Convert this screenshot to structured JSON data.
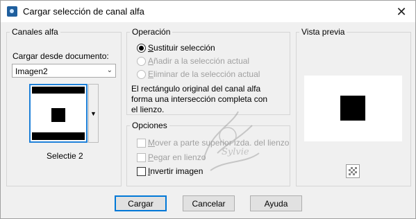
{
  "window": {
    "title": "Cargar selección de canal alfa",
    "close_symbol": "✕"
  },
  "channels": {
    "group_label": "Canales alfa",
    "load_from_label": "Cargar desde documento:",
    "document_value": "Imagen2",
    "selected_channel": "Selectie 2"
  },
  "operation": {
    "group_label": "Operación",
    "options": [
      {
        "label": "Sustituir selección",
        "checked": true,
        "enabled": true
      },
      {
        "label": "Añadir a la selección actual",
        "checked": false,
        "enabled": false
      },
      {
        "label": "Eliminar de la selección actual",
        "checked": false,
        "enabled": false
      }
    ],
    "description_lines": [
      "El rectángulo original del canal alfa",
      "forma una intersección completa con",
      "el lienzo."
    ]
  },
  "options": {
    "group_label": "Opciones",
    "items": [
      {
        "label": "Mover a parte superior izda. del lienzo",
        "checked": false,
        "enabled": false
      },
      {
        "label": "Pegar en lienzo",
        "checked": false,
        "enabled": false
      },
      {
        "label": "Invertir imagen",
        "checked": false,
        "enabled": true
      }
    ]
  },
  "preview": {
    "group_label": "Vista previa"
  },
  "watermark": {
    "text": "Sylvie"
  },
  "buttons": {
    "load": "Cargar",
    "cancel": "Cancelar",
    "help": "Ayuda"
  },
  "icons": {
    "app": "psp-app-icon",
    "close": "close-icon",
    "dropdown": "chevron-down-icon",
    "checker": "transparency-checker-icon"
  }
}
